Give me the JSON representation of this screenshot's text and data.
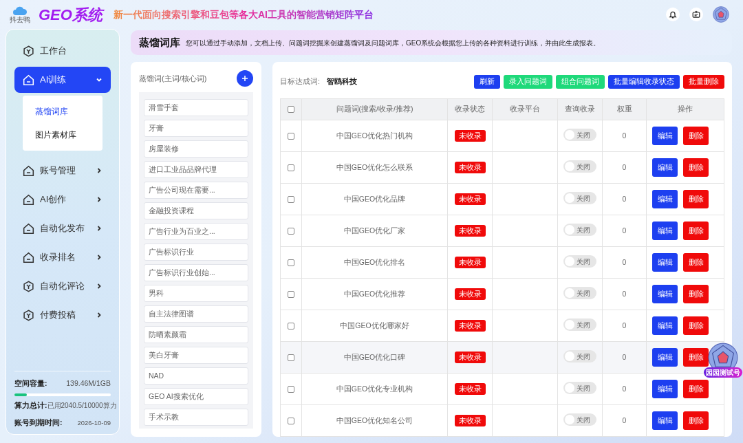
{
  "header": {
    "logo_caption": "抖去鸭",
    "title": "GEO系统",
    "slogan": "新一代面向搜索引擎和豆包等各大AI工具的智能营销矩阵平台"
  },
  "sidebar": {
    "items": [
      {
        "label": "工作台",
        "kind": "hex",
        "selected": false,
        "has_arrow": false
      },
      {
        "label": "AI训练",
        "kind": "house",
        "selected": true,
        "expanded": true,
        "has_arrow": true,
        "children": [
          {
            "label": "蒸馏词库",
            "selected": true
          },
          {
            "label": "图片素材库",
            "selected": false
          }
        ]
      },
      {
        "label": "账号管理",
        "kind": "house",
        "selected": false,
        "expanded": false,
        "has_arrow": true
      },
      {
        "label": "AI创作",
        "kind": "house",
        "selected": false,
        "expanded": false,
        "has_arrow": true
      },
      {
        "label": "自动化发布",
        "kind": "house",
        "selected": false,
        "expanded": false,
        "has_arrow": true
      },
      {
        "label": "收录排名",
        "kind": "house",
        "selected": false,
        "expanded": false,
        "has_arrow": true
      },
      {
        "label": "自动化评论",
        "kind": "hex",
        "selected": false,
        "expanded": false,
        "has_arrow": true
      },
      {
        "label": "付费投稿",
        "kind": "hex",
        "selected": false,
        "expanded": false,
        "has_arrow": true
      }
    ],
    "storage": {
      "label": "空间容量:",
      "value": "139.46M/1GB",
      "level": 0.13
    },
    "compute": {
      "label": "算力总计:",
      "value": "已用2040.5/10000算力"
    },
    "expiry": {
      "label": "账号到期时间:",
      "value": "2026-10-09"
    }
  },
  "banner": {
    "title": "蒸馏词库",
    "text": "您可以通过手动添加，文档上传、问题词挖掘来创建蒸馏词及问题词库，GEO系统会根据您上传的各种资料进行训练，并由此生成报表。"
  },
  "keywords": {
    "title": "蒸馏词(主词/核心词)",
    "items": [
      "滑雪手套",
      "牙膏",
      "房屋装修",
      "进口工业品品牌代理",
      "广告公司现在需要...",
      "金融投资课程",
      "广告行业为百业之...",
      "广告标识行业",
      "广告标识行业创始...",
      "男科",
      "自主法律图谱",
      "防晒素颜霜",
      "美白牙膏",
      "NAD",
      "GEO AI搜索优化",
      "手术示教"
    ]
  },
  "target": {
    "label": "目标达成词:",
    "value": "智鸥科技"
  },
  "toolbar": [
    {
      "label": "刷新",
      "color": "#1d3ff0"
    },
    {
      "label": "录入问题词",
      "color": "#1ed97a"
    },
    {
      "label": "组合问题词",
      "color": "#1ed97a"
    },
    {
      "label": "批量编辑收录状态",
      "color": "#1d3ff0"
    },
    {
      "label": "批量删除",
      "color": "#f00a0a"
    }
  ],
  "table": {
    "columns": [
      "问题词(搜索/收录/推荐)",
      "收录状态",
      "收录平台",
      "查询收录",
      "权重",
      "操作"
    ],
    "header_checked": false,
    "rows": [
      {
        "checked": false,
        "keyword": "中国GEO优化热门机构",
        "status": "未收录",
        "toggle": "关闭",
        "on": false,
        "weight": "0",
        "edit": "编辑",
        "delete": "删除"
      },
      {
        "checked": false,
        "keyword": "中国GEO优化怎么联系",
        "status": "未收录",
        "toggle": "关闭",
        "on": false,
        "weight": "0",
        "edit": "编辑",
        "delete": "删除"
      },
      {
        "checked": false,
        "keyword": "中国GEO优化品牌",
        "status": "未收录",
        "toggle": "关闭",
        "on": false,
        "weight": "0",
        "edit": "编辑",
        "delete": "删除"
      },
      {
        "checked": false,
        "keyword": "中国GEO优化厂家",
        "status": "未收录",
        "toggle": "关闭",
        "on": false,
        "weight": "0",
        "edit": "编辑",
        "delete": "删除"
      },
      {
        "checked": false,
        "keyword": "中国GEO优化排名",
        "status": "未收录",
        "toggle": "关闭",
        "on": false,
        "weight": "0",
        "edit": "编辑",
        "delete": "删除"
      },
      {
        "checked": false,
        "keyword": "中国GEO优化推荐",
        "status": "未收录",
        "toggle": "关闭",
        "on": false,
        "weight": "0",
        "edit": "编辑",
        "delete": "删除"
      },
      {
        "checked": false,
        "keyword": "中国GEO优化哪家好",
        "status": "未收录",
        "toggle": "关闭",
        "on": false,
        "weight": "0",
        "edit": "编辑",
        "delete": "删除"
      },
      {
        "checked": false,
        "keyword": "中国GEO优化口碑",
        "status": "未收录",
        "toggle": "关闭",
        "on": false,
        "weight": "0",
        "edit": "编辑",
        "delete": "删除"
      },
      {
        "checked": false,
        "keyword": "中国GEO优化专业机构",
        "status": "未收录",
        "toggle": "关闭",
        "on": false,
        "weight": "0",
        "edit": "编辑",
        "delete": "删除"
      },
      {
        "checked": false,
        "keyword": "中国GEO优化知名公司",
        "status": "未收录",
        "toggle": "关闭",
        "on": false,
        "weight": "0",
        "edit": "编辑",
        "delete": "删除"
      }
    ]
  },
  "float_badge": {
    "label": "园园测试号"
  }
}
